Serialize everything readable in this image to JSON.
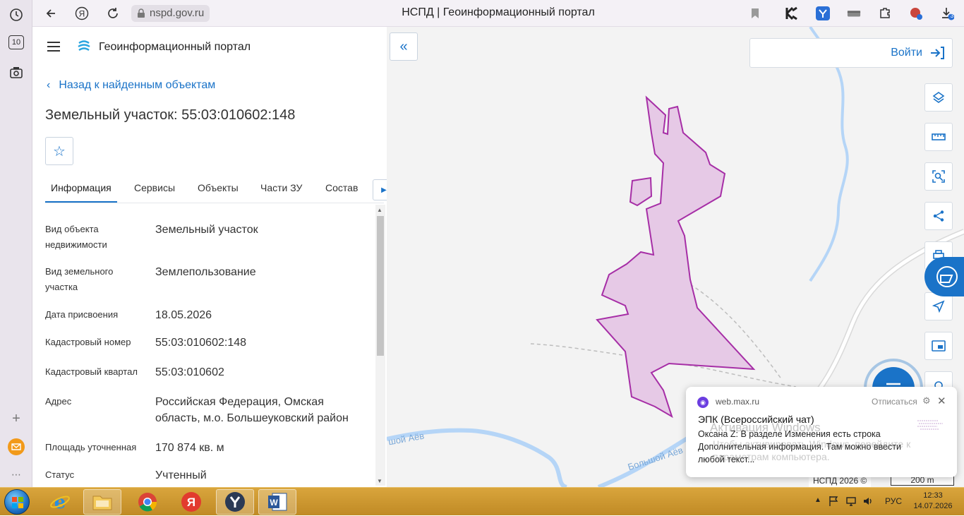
{
  "browser": {
    "url": "nspd.gov.ru",
    "page_title": "НСПД | Геоинформационный портал",
    "rail_tab_count": "10",
    "downloads_badge": "3"
  },
  "portal": {
    "name": "Геоинформационный портал",
    "back_label": "Назад к найденным объектам",
    "object_title": "Земельный участок: 55:03:010602:148"
  },
  "tabs": [
    "Информация",
    "Сервисы",
    "Объекты",
    "Части ЗУ",
    "Состав"
  ],
  "properties": [
    {
      "label": "Вид объекта недвижимости",
      "value": "Земельный участок"
    },
    {
      "label": "Вид земельного участка",
      "value": "Землепользование"
    },
    {
      "label": "Дата присвоения",
      "value": "18.05.2026"
    },
    {
      "label": "Кадастровый номер",
      "value": "55:03:010602:148"
    },
    {
      "label": "Кадастровый квартал",
      "value": "55:03:010602"
    },
    {
      "label": "Адрес",
      "value": "Российская Федерация, Омская область, м.о. Большеуковский район"
    },
    {
      "label": "Площадь уточненная",
      "value": "170 874 кв. м"
    },
    {
      "label": "Статус",
      "value": "Учтенный"
    }
  ],
  "map": {
    "login_label": "Войти",
    "river_label_1": "шой Аёв",
    "river_label_2": "Большой Аёв",
    "copyright": "НСПД 2026 ©",
    "scale": "200 m",
    "parcel_fill": "#e6c9e6",
    "parcel_stroke": "#a62ea6",
    "river_color": "#b5d5f7"
  },
  "notification": {
    "site": "web.max.ru",
    "unsubscribe": "Отписаться",
    "title": "ЭПК (Всероссийский чат)",
    "body": "Оксана Z: В разделе Изменения есть строка Дополнительная информация. Там можно ввести любой текст...",
    "watermark_1": "Активация Windows",
    "watermark_2": "Чтобы активировать Windows, перейдите к параметрам компьютера."
  },
  "taskbar": {
    "language": "РУС",
    "time": "12:33",
    "date": "14.07.2026"
  },
  "accent_color": "#1a73c8"
}
